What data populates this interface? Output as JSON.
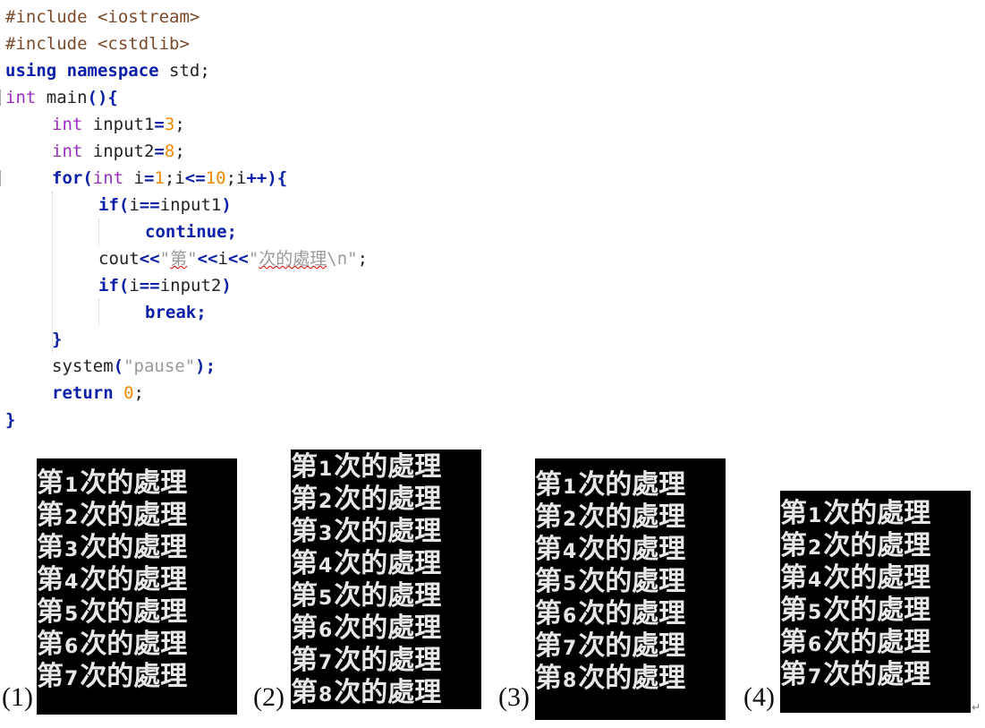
{
  "code_lines": [
    {
      "indent": 0,
      "tokens": [
        {
          "t": "#include <iostream>",
          "c": "pp"
        }
      ]
    },
    {
      "indent": 0,
      "tokens": [
        {
          "t": "#include <cstdlib>",
          "c": "pp"
        }
      ]
    },
    {
      "indent": 0,
      "tokens": [
        {
          "t": "using",
          "c": "kw"
        },
        {
          "t": " ",
          "c": "plain"
        },
        {
          "t": "namespace",
          "c": "kw"
        },
        {
          "t": " std;",
          "c": "plain"
        }
      ]
    },
    {
      "indent": 0,
      "tokens": [
        {
          "t": "int",
          "c": "ty"
        },
        {
          "t": " main",
          "c": "plain"
        },
        {
          "t": "(){",
          "c": "op"
        }
      ]
    },
    {
      "indent": 1,
      "tokens": [
        {
          "t": "int",
          "c": "ty"
        },
        {
          "t": " input1",
          "c": "plain"
        },
        {
          "t": "=",
          "c": "op"
        },
        {
          "t": "3",
          "c": "num"
        },
        {
          "t": ";",
          "c": "plain"
        }
      ]
    },
    {
      "indent": 1,
      "tokens": [
        {
          "t": "int",
          "c": "ty"
        },
        {
          "t": " input2",
          "c": "plain"
        },
        {
          "t": "=",
          "c": "op"
        },
        {
          "t": "8",
          "c": "num"
        },
        {
          "t": ";",
          "c": "plain"
        }
      ]
    },
    {
      "indent": 1,
      "tokens": [
        {
          "t": "for",
          "c": "kw"
        },
        {
          "t": "(",
          "c": "op"
        },
        {
          "t": "int",
          "c": "ty"
        },
        {
          "t": " i",
          "c": "plain"
        },
        {
          "t": "=",
          "c": "op"
        },
        {
          "t": "1",
          "c": "num"
        },
        {
          "t": ";i",
          "c": "plain"
        },
        {
          "t": "<=",
          "c": "op"
        },
        {
          "t": "10",
          "c": "num"
        },
        {
          "t": ";i",
          "c": "plain"
        },
        {
          "t": "++){",
          "c": "op"
        }
      ]
    },
    {
      "indent": 2,
      "tokens": [
        {
          "t": "if",
          "c": "kw"
        },
        {
          "t": "(",
          "c": "op"
        },
        {
          "t": "i",
          "c": "plain"
        },
        {
          "t": "==",
          "c": "op"
        },
        {
          "t": "input1",
          "c": "plain"
        },
        {
          "t": ")",
          "c": "op"
        }
      ]
    },
    {
      "indent": 3,
      "tokens": [
        {
          "t": "continue",
          "c": "kw"
        },
        {
          "t": ";",
          "c": "op"
        }
      ]
    },
    {
      "indent": 2,
      "tokens": [
        {
          "t": "cout",
          "c": "plain"
        },
        {
          "t": "<<",
          "c": "op"
        },
        {
          "t": "\"",
          "c": "str"
        },
        {
          "t": "第",
          "c": "cjk"
        },
        {
          "t": "\"",
          "c": "str"
        },
        {
          "t": "<<",
          "c": "op"
        },
        {
          "t": "i",
          "c": "plain"
        },
        {
          "t": "<<",
          "c": "op"
        },
        {
          "t": "\"",
          "c": "str"
        },
        {
          "t": "次的處理",
          "c": "cjk"
        },
        {
          "t": "\\n\"",
          "c": "str"
        },
        {
          "t": ";",
          "c": "plain"
        }
      ]
    },
    {
      "indent": 2,
      "tokens": [
        {
          "t": "if",
          "c": "kw"
        },
        {
          "t": "(",
          "c": "op"
        },
        {
          "t": "i",
          "c": "plain"
        },
        {
          "t": "==",
          "c": "op"
        },
        {
          "t": "input2",
          "c": "plain"
        },
        {
          "t": ")",
          "c": "op"
        }
      ]
    },
    {
      "indent": 3,
      "tokens": [
        {
          "t": "break",
          "c": "kw"
        },
        {
          "t": ";",
          "c": "op"
        }
      ]
    },
    {
      "indent": 1,
      "tokens": [
        {
          "t": "}",
          "c": "op"
        }
      ]
    },
    {
      "indent": 1,
      "tokens": [
        {
          "t": "system",
          "c": "plain"
        },
        {
          "t": "(",
          "c": "op"
        },
        {
          "t": "\"pause\"",
          "c": "str"
        },
        {
          "t": ");",
          "c": "op"
        }
      ]
    },
    {
      "indent": 1,
      "tokens": [
        {
          "t": "return",
          "c": "kw"
        },
        {
          "t": " ",
          "c": "plain"
        },
        {
          "t": "0",
          "c": "num"
        },
        {
          "t": ";",
          "c": "plain"
        }
      ]
    },
    {
      "indent": 0,
      "tokens": [
        {
          "t": "}",
          "c": "op"
        }
      ]
    }
  ],
  "options": [
    {
      "label": "(1)",
      "lines": [
        [
          "第",
          "1",
          "次的處理"
        ],
        [
          "第",
          "2",
          "次的處理"
        ],
        [
          "第",
          "3",
          "次的處理"
        ],
        [
          "第",
          "4",
          "次的處理"
        ],
        [
          "第",
          "5",
          "次的處理"
        ],
        [
          "第",
          "6",
          "次的處理"
        ],
        [
          "第",
          "7",
          "次的處理"
        ]
      ]
    },
    {
      "label": "(2)",
      "lines": [
        [
          "第",
          "1",
          "次的處理"
        ],
        [
          "第",
          "2",
          "次的處理"
        ],
        [
          "第",
          "3",
          "次的處理"
        ],
        [
          "第",
          "4",
          "次的處理"
        ],
        [
          "第",
          "5",
          "次的處理"
        ],
        [
          "第",
          "6",
          "次的處理"
        ],
        [
          "第",
          "7",
          "次的處理"
        ],
        [
          "第",
          "8",
          "次的處理"
        ]
      ]
    },
    {
      "label": "(3)",
      "lines": [
        [
          "第",
          "1",
          "次的處理"
        ],
        [
          "第",
          "2",
          "次的處理"
        ],
        [
          "第",
          "4",
          "次的處理"
        ],
        [
          "第",
          "5",
          "次的處理"
        ],
        [
          "第",
          "6",
          "次的處理"
        ],
        [
          "第",
          "7",
          "次的處理"
        ],
        [
          "第",
          "8",
          "次的處理"
        ]
      ]
    },
    {
      "label": "(4)",
      "lines": [
        [
          "第",
          "1",
          "次的處理"
        ],
        [
          "第",
          "2",
          "次的處理"
        ],
        [
          "第",
          "4",
          "次的處理"
        ],
        [
          "第",
          "5",
          "次的處理"
        ],
        [
          "第",
          "6",
          "次的處理"
        ],
        [
          "第",
          "7",
          "次的處理"
        ]
      ]
    }
  ],
  "colors": {
    "preprocessor": "#7a4a2a",
    "keyword": "#0b1fa8",
    "type": "#9a2fbf",
    "number": "#f08a00",
    "string": "#9a9a9a",
    "console_bg": "#000000",
    "console_fg": "#e8e8e8"
  }
}
